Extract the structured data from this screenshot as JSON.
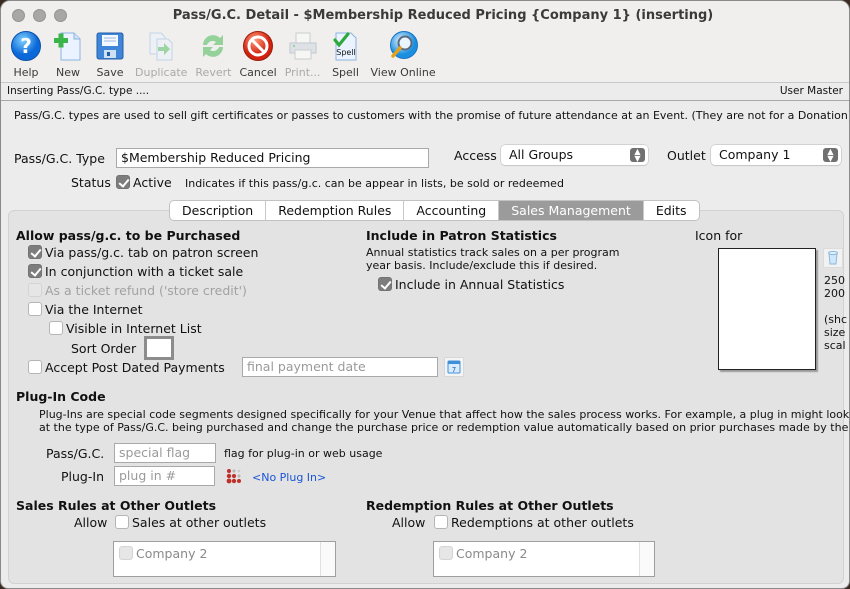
{
  "window": {
    "title": "Pass/G.C. Detail - $Membership Reduced Pricing {Company 1} (inserting)"
  },
  "toolbar": {
    "items": [
      {
        "label": "Help",
        "icon": "help-icon",
        "enabled": true
      },
      {
        "label": "New",
        "icon": "new-document-icon",
        "enabled": true
      },
      {
        "label": "Save",
        "icon": "floppy-disk-icon",
        "enabled": true
      },
      {
        "label": "Duplicate",
        "icon": "duplicate-icon",
        "enabled": false
      },
      {
        "label": "Revert",
        "icon": "revert-arrows-icon",
        "enabled": false
      },
      {
        "label": "Cancel",
        "icon": "cancel-icon",
        "enabled": true
      },
      {
        "label": "Print...",
        "icon": "printer-icon",
        "enabled": false
      },
      {
        "label": "Spell",
        "icon": "spell-check-icon",
        "enabled": true
      },
      {
        "label": "View Online",
        "icon": "magnifier-globe-icon",
        "enabled": true
      }
    ],
    "spell_icon_text": "Spell"
  },
  "statusbar": {
    "left": "Inserting Pass/G.C. type ....",
    "right": "User Master"
  },
  "intro": "Pass/G.C. types are used to sell gift certificates or passes to customers with the promise of future attendance at an Event.  (They are not for a Donation).",
  "form": {
    "type_label": "Pass/G.C. Type",
    "type_value": "$Membership Reduced Pricing",
    "access_label": "Access",
    "access_value": "All Groups",
    "outlet_label": "Outlet",
    "outlet_value": "Company 1",
    "status_label": "Status",
    "active_label": "Active",
    "active_checked": true,
    "status_hint": "Indicates if this pass/g.c. can be appear in lists, be sold or redeemed"
  },
  "tabs": [
    {
      "label": "Description",
      "active": false
    },
    {
      "label": "Redemption Rules",
      "active": false
    },
    {
      "label": "Accounting",
      "active": false
    },
    {
      "label": "Sales Management",
      "active": true
    },
    {
      "label": "Edits",
      "active": false
    }
  ],
  "purchase": {
    "heading": "Allow pass/g.c. to be Purchased",
    "via_tab": {
      "label": "Via pass/g.c. tab on patron screen",
      "checked": true
    },
    "with_ticket": {
      "label": "In conjunction with a ticket sale",
      "checked": true
    },
    "ticket_refund": {
      "label": "As a ticket refund ('store credit')",
      "checked": false,
      "disabled": true
    },
    "via_internet": {
      "label": "Via the Internet",
      "checked": false
    },
    "visible_internet": {
      "label": "Visible in Internet List",
      "checked": false
    },
    "sort_order_label": "Sort Order",
    "sort_order_value": "",
    "post_dated": {
      "label": "Accept Post Dated Payments",
      "checked": false
    },
    "final_payment_placeholder": "final payment date"
  },
  "statistics": {
    "heading": "Include in Patron Statistics",
    "description_line1": "Annual statistics track sales on a per program",
    "description_line2": "year basis.  Include/exclude this if desired.",
    "include": {
      "label": "Include in Annual Statistics",
      "checked": true
    }
  },
  "icon_panel": {
    "heading": "Icon for",
    "dim_line1": "250",
    "dim_line2": "200",
    "note_line1": "(shc",
    "note_line2": "size",
    "note_line3": "scal"
  },
  "plugin": {
    "heading": "Plug-In Code",
    "description_line1": "Plug-Ins are special code segments designed specifically for your Venue that affect how the sales process works.   For example, a plug in might look",
    "description_line2": "at the type of Pass/G.C. being purchased and change the purchase price or redemption value automatically based on prior purchases made by the",
    "flag_label": "Pass/G.C.",
    "flag_placeholder": "special flag",
    "flag_hint": "flag for plug-in or web usage",
    "plugin_label": "Plug-In",
    "plugin_placeholder": "plug in #",
    "plugin_link": "<No Plug In>"
  },
  "sales_rules": {
    "heading": "Sales Rules at Other Outlets",
    "allow_label": "Allow",
    "checkbox_label": "Sales at other outlets",
    "checked": false,
    "outlets": [
      {
        "label": "Company 2",
        "checked": false
      }
    ]
  },
  "redemption_rules": {
    "heading": "Redemption Rules at Other Outlets",
    "allow_label": "Allow",
    "checkbox_label": "Redemptions at other outlets",
    "checked": false,
    "outlets": [
      {
        "label": "Company 2",
        "checked": false
      }
    ]
  },
  "colors": {
    "active_tab": "#9b9b9b",
    "link": "#1a55d8",
    "checkbox_on": "#7d7d7d"
  }
}
